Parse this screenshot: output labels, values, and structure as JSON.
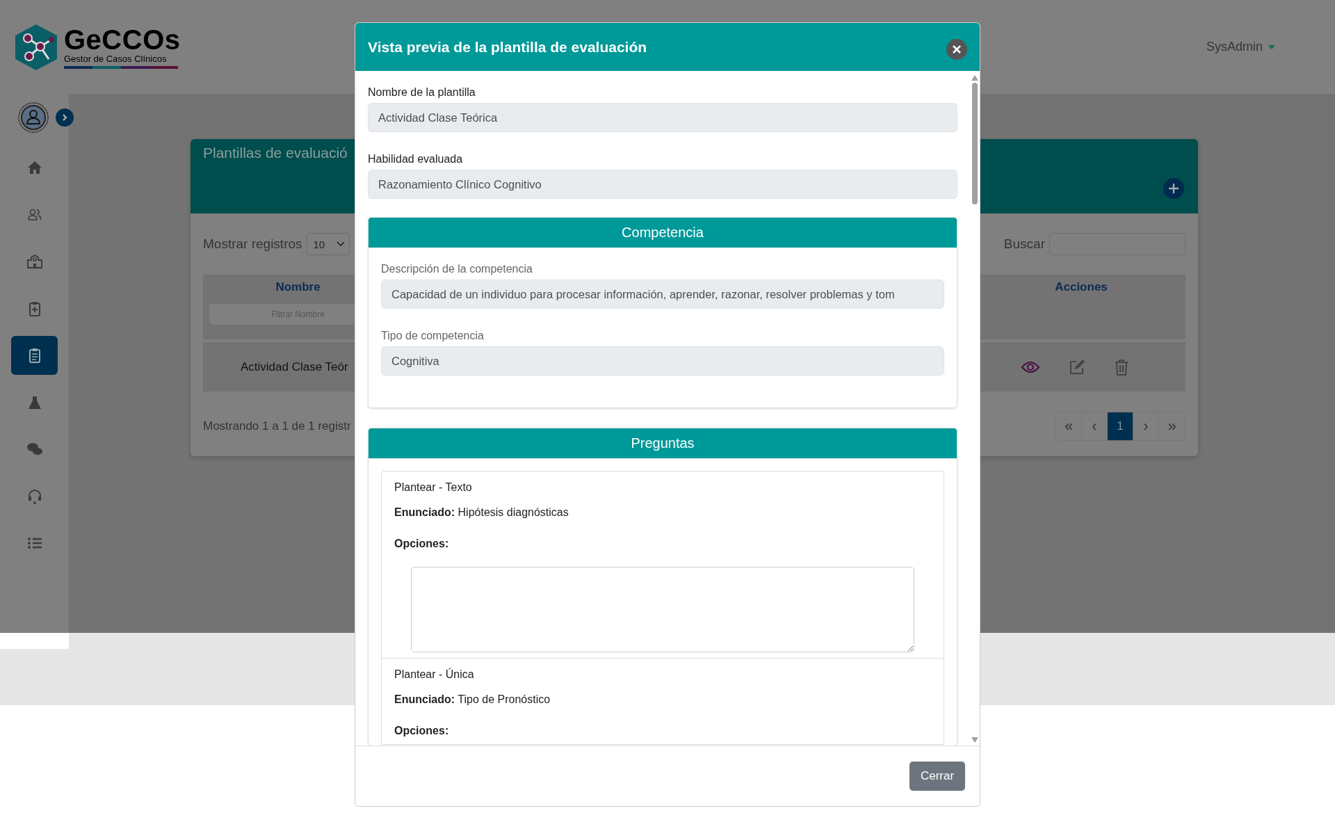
{
  "header": {
    "logo_title": "GeCCOs",
    "logo_subtitle": "Gestor de Casos Clínicos",
    "user_menu": "SysAdmin"
  },
  "sidebar": {
    "items": [
      {
        "selected": false
      },
      {
        "selected": false
      },
      {
        "selected": false
      },
      {
        "selected": false
      },
      {
        "selected": true
      },
      {
        "selected": false
      },
      {
        "selected": false
      },
      {
        "selected": false
      },
      {
        "selected": false
      }
    ]
  },
  "page": {
    "card_title": "Plantillas de evaluació",
    "length_label": "Mostrar registros",
    "length_value": "10",
    "search_label": "Buscar",
    "table": {
      "columns": [
        "Nombre",
        "Acciones"
      ],
      "filter_placeholder": "Filtrar Nombre",
      "rows": [
        {
          "nombre": "Actividad Clase Teór"
        }
      ]
    },
    "info": "Mostrando 1 a 1 de 1 registr",
    "pagination": [
      {
        "label": "«",
        "selected": false
      },
      {
        "label": "‹",
        "selected": false
      },
      {
        "label": "1",
        "selected": true
      },
      {
        "label": "›",
        "selected": false
      },
      {
        "label": "»",
        "selected": false
      }
    ]
  },
  "modal": {
    "title": "Vista previa de la plantilla de evaluación",
    "fields": [
      {
        "label": "Nombre de la plantilla",
        "value": "Actividad Clase Teórica"
      },
      {
        "label": "Habilidad evaluada",
        "value": "Razonamiento Clínico Cognitivo"
      }
    ],
    "competencia": {
      "title": "Competencia",
      "fields": [
        {
          "label": "Descripción de la competencia",
          "value": "Capacidad de un individuo para procesar información, aprender, razonar, resolver problemas y tom"
        },
        {
          "label": "Tipo de competencia",
          "value": "Cognitiva"
        }
      ]
    },
    "preguntas": {
      "title": "Preguntas",
      "items": [
        {
          "kind": "text",
          "type_label": "Plantear - Texto",
          "statement": "**Enunciado:** Hipótesis diagnósticas",
          "options_label": "Opciones:"
        },
        {
          "kind": "single",
          "type_label": "Plantear - Única",
          "statement": "**Enunciado:** Tipo de Pronóstico",
          "options_label": "Opciones:"
        }
      ]
    },
    "close_button": "Cerrar"
  }
}
